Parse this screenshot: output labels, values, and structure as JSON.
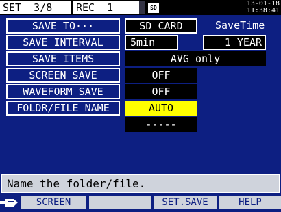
{
  "header": {
    "set_tab": "SET  3/8",
    "rec_tab": "REC  1",
    "sd_icon": "SD",
    "date": "13-01-18",
    "time": "11:38:41"
  },
  "rows": [
    {
      "label": "SAVE TO···",
      "value": "SD CARD",
      "extra_label": "SaveTime"
    },
    {
      "label": "SAVE INTERVAL",
      "value": "5min",
      "extra_value": "1 YEAR"
    },
    {
      "label": "SAVE ITEMS",
      "value": "AVG only"
    },
    {
      "label": "SCREEN SAVE",
      "value": "OFF"
    },
    {
      "label": "WAVEFORM SAVE",
      "value": "OFF"
    },
    {
      "label": "FOLDR/FILE NAME",
      "value": "AUTO"
    },
    {
      "value": "-----"
    }
  ],
  "message": "Name the folder/file.",
  "fkeys": {
    "f1": "SCREEN",
    "f2": "",
    "f3": "SET.SAVE",
    "f4": "HELP"
  },
  "icons": {
    "hand_pointer": "hand-pointer-icon",
    "sd_card": "sd-card-icon"
  },
  "colors": {
    "background": "#0d1f82",
    "selected": "#ffff00",
    "value_bg": "#000000"
  }
}
